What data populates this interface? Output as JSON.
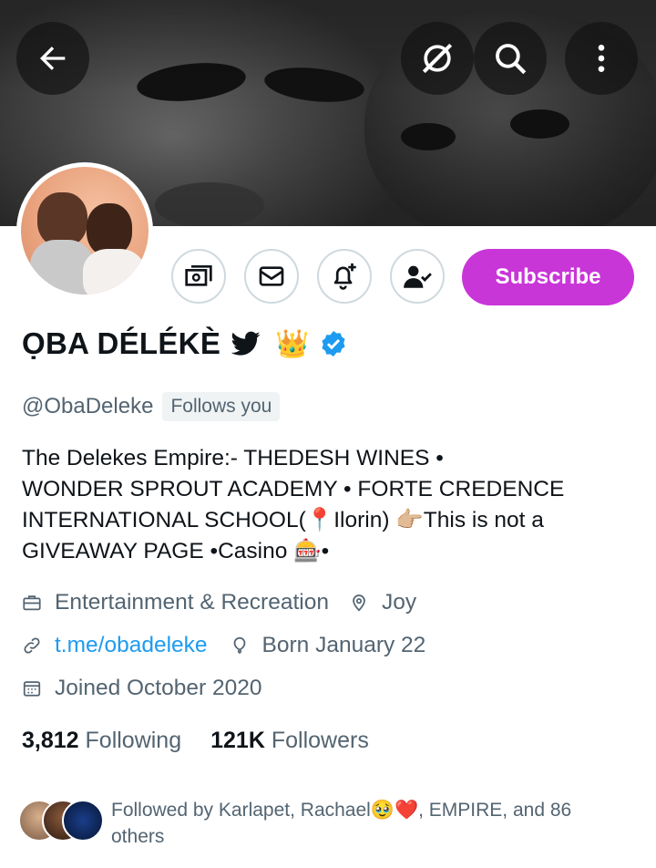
{
  "header": {
    "back_icon": "arrow-left-icon",
    "grok_icon": "grok-slash-icon",
    "search_icon": "search-icon",
    "more_icon": "more-vertical-icon"
  },
  "actions": {
    "tip_icon": "money-icon",
    "message_icon": "envelope-icon",
    "notify_icon": "bell-plus-icon",
    "following_icon": "person-check-icon",
    "subscribe_label": "Subscribe"
  },
  "profile": {
    "name": "ỌBA DÉLÉKÈ",
    "name_emoji": "👑",
    "handle": "@ObaDeleke",
    "follows_you": "Follows you",
    "bio_lines": [
      "The Delekes Empire:- THEDESH WINES •",
      "WONDER SPROUT ACADEMY • FORTE CREDENCE",
      "INTERNATIONAL SCHOOL(📍Ilorin) 👉🏼This is not a",
      "GIVEAWAY PAGE •Casino 🎰•"
    ],
    "category": "Entertainment & Recreation",
    "location": "Joy",
    "website": "t.me/obadeleke",
    "birthday": "Born January 22",
    "joined": "Joined October 2020"
  },
  "stats": {
    "following_count": "3,812",
    "following_label": "Following",
    "followers_count": "121K",
    "followers_label": "Followers"
  },
  "followed_by": {
    "text": "Followed by Karlapet, Rachael🥹❤️, EMPIRE, and 86 others"
  },
  "colors": {
    "accent": "#1d9bf0",
    "subscribe": "#c936d8",
    "secondary_text": "#536471",
    "verified": "#1d9bf0"
  }
}
